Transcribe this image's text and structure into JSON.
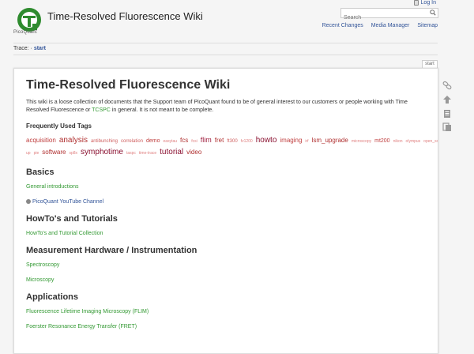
{
  "header": {
    "logo_text": "PicoQuant",
    "title": "Time-Resolved Fluorescence Wiki",
    "login": "Log In",
    "search_placeholder": "Search",
    "links": [
      "Recent Changes",
      "Media Manager",
      "Sitemap"
    ]
  },
  "trace": {
    "label": "Trace:",
    "sep": "·",
    "item": "start"
  },
  "page_tab": "start",
  "content": {
    "title": "Time-Resolved Fluorescence Wiki",
    "intro_pre": "This wiki is a loose collection of documents that the Support team of PicoQuant found to be of general interest to our customers or people working with Time Resolved Fluorescence or ",
    "intro_link": "TCSPC",
    "intro_post": " in general. It is not meant to be complete.",
    "tags_heading": "Frequently Used Tags",
    "tags": [
      {
        "t": "acquisition",
        "s": 8,
        "c": "#c04040"
      },
      {
        "t": "analysis",
        "s": 10,
        "c": "#b03030"
      },
      {
        "t": "antibunching",
        "s": 6,
        "c": "#d06060"
      },
      {
        "t": "correlation",
        "s": 6,
        "c": "#d06060"
      },
      {
        "t": "demo",
        "s": 7,
        "c": "#c04040"
      },
      {
        "t": "easytau",
        "s": 5,
        "c": "#e08080"
      },
      {
        "t": "fcs",
        "s": 8,
        "c": "#b03030"
      },
      {
        "t": "fcsi",
        "s": 5,
        "c": "#e08080"
      },
      {
        "t": "flim",
        "s": 9,
        "c": "#a02040"
      },
      {
        "t": "fret",
        "s": 8,
        "c": "#b03030"
      },
      {
        "t": "ft300",
        "s": 6,
        "c": "#d06060"
      },
      {
        "t": "fv1200",
        "s": 5,
        "c": "#e08080"
      },
      {
        "t": "howto",
        "s": 10,
        "c": "#8a1030"
      },
      {
        "t": "imaging",
        "s": 8,
        "c": "#c04040"
      },
      {
        "t": "irf",
        "s": 5,
        "c": "#e08080"
      },
      {
        "t": "lsm_upgrade",
        "s": 8,
        "c": "#b03030"
      },
      {
        "t": "microscopy",
        "s": 5,
        "c": "#e08080"
      },
      {
        "t": "mt200",
        "s": 7,
        "c": "#c04040"
      },
      {
        "t": "nikon",
        "s": 5,
        "c": "#e08080"
      },
      {
        "t": "olympus",
        "s": 5,
        "c": "#e08080"
      },
      {
        "t": "open_source",
        "s": 5,
        "c": "#e08080"
      },
      {
        "t": "pile-up",
        "s": 5,
        "c": "#e08080"
      },
      {
        "t": "pie",
        "s": 5,
        "c": "#e08080"
      },
      {
        "t": "software",
        "s": 8,
        "c": "#b03030"
      },
      {
        "t": "sp8x",
        "s": 5,
        "c": "#e08080"
      },
      {
        "t": "symphotime",
        "s": 10,
        "c": "#8a1030"
      },
      {
        "t": "taspc",
        "s": 5,
        "c": "#e08080"
      },
      {
        "t": "time-trace",
        "s": 5,
        "c": "#e08080"
      },
      {
        "t": "tutorial",
        "s": 10,
        "c": "#8a1030"
      },
      {
        "t": "video",
        "s": 8,
        "c": "#b03030"
      }
    ],
    "sections": [
      {
        "heading": "Basics",
        "links": [
          "General introductions",
          "PicoQuant YouTube Channel"
        ]
      },
      {
        "heading": "HowTo's and Tutorials",
        "links": [
          "HowTo's and Tutorial Collection"
        ]
      },
      {
        "heading": "Measurement Hardware / Instrumentation",
        "links": [
          "Spectroscopy",
          "Microscopy"
        ]
      },
      {
        "heading": "Applications",
        "links": [
          "Fluorescence Lifetime Imaging Microscopy (FLIM)",
          "Foerster Resonance Energy Transfer (FRET)"
        ]
      }
    ]
  },
  "page_tools": [
    "link-icon",
    "back-to-top-icon",
    "old-revisions-icon",
    "backlinks-icon"
  ]
}
